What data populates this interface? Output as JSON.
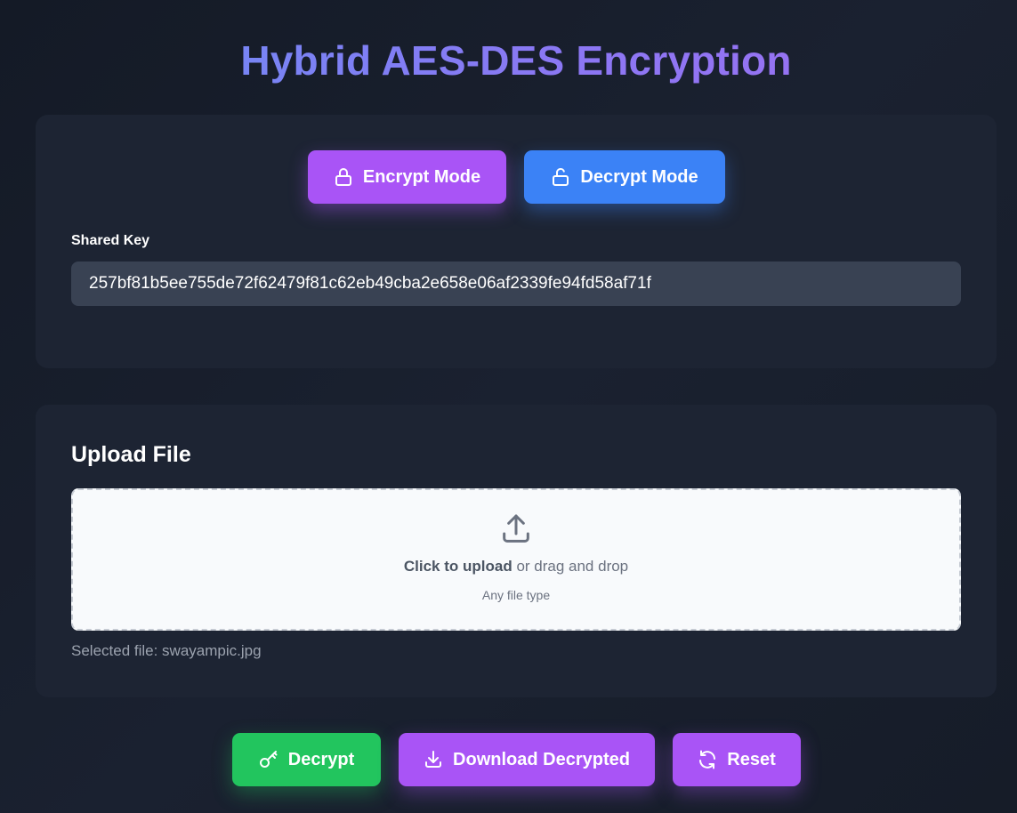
{
  "header": {
    "title": "Hybrid AES-DES Encryption"
  },
  "mode": {
    "encrypt_label": "Encrypt Mode",
    "decrypt_label": "Decrypt Mode",
    "encrypt_icon": "lock-icon",
    "decrypt_icon": "unlock-icon"
  },
  "key": {
    "label": "Shared Key",
    "value": "257bf81b5ee755de72f62479f81c62eb49cba2e658e06af2339fe94fd58af71f"
  },
  "upload": {
    "heading": "Upload File",
    "click_text": "Click to upload",
    "drag_text": "or drag and drop",
    "hint": "Any file type",
    "selected_file": "Selected file: swayampic.jpg",
    "icon": "upload-icon"
  },
  "actions": {
    "decrypt_label": "Decrypt",
    "download_label": "Download Decrypted",
    "reset_label": "Reset"
  },
  "colors": {
    "purple": "#a954f6",
    "blue": "#3b82f6",
    "green": "#22c55e",
    "card": "#1d2433",
    "input": "#394253"
  }
}
